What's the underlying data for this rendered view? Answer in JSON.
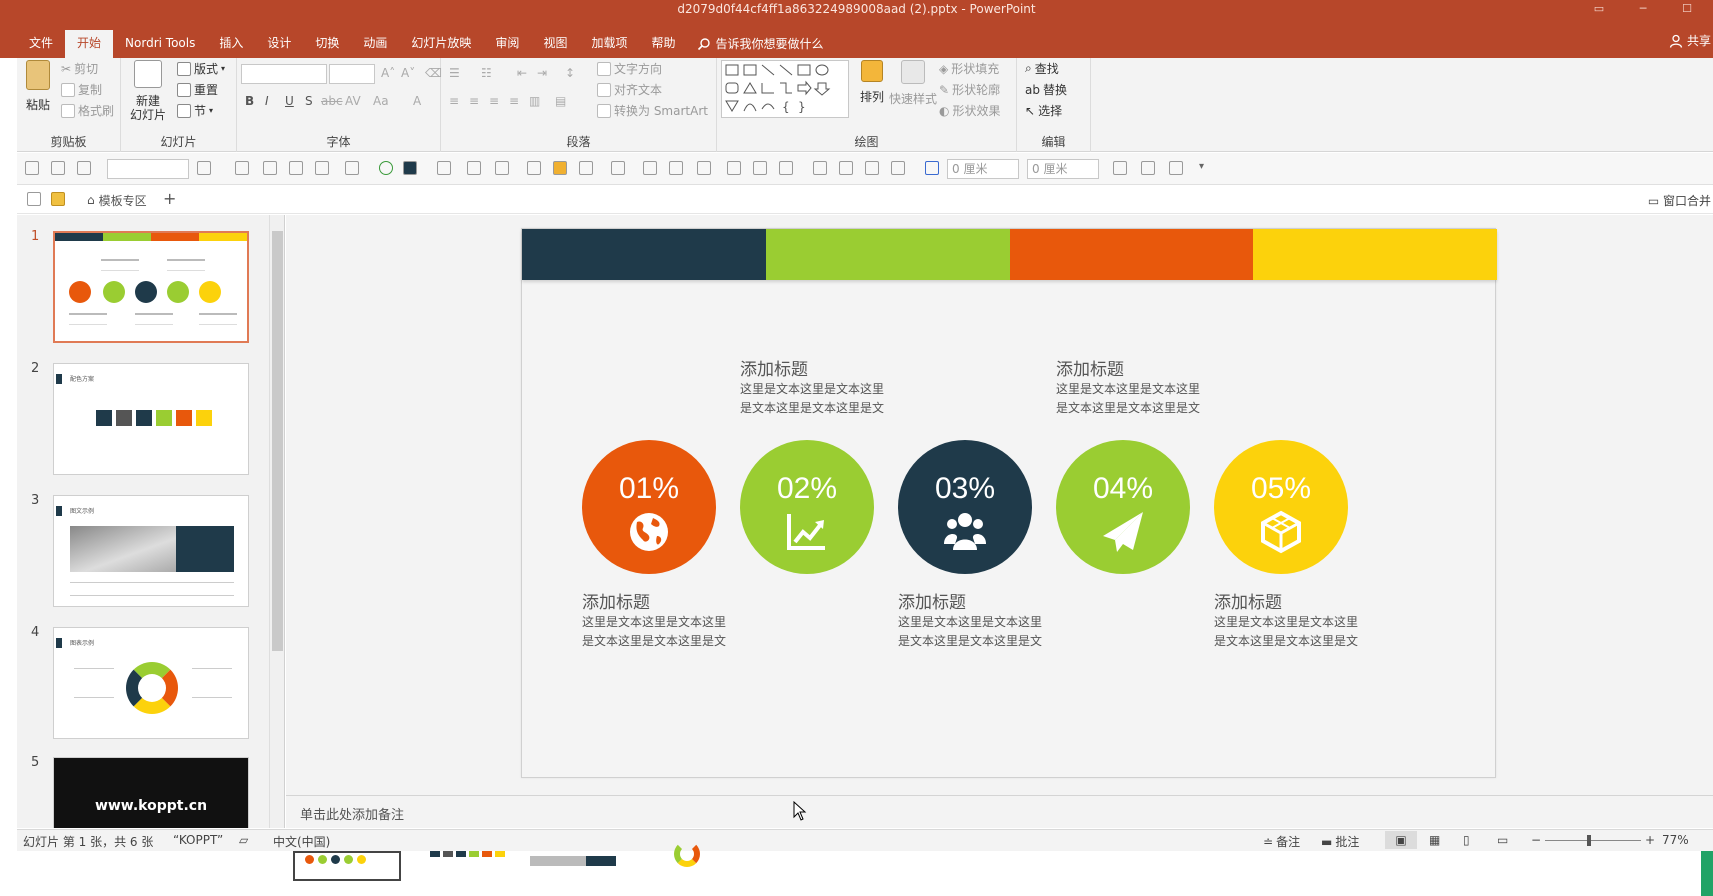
{
  "window": {
    "title": "d2079d0f44cf4ff1a863224989008aad (2).pptx  -  PowerPoint"
  },
  "tabs": [
    "文件",
    "开始",
    "Nordri Tools",
    "插入",
    "设计",
    "切换",
    "动画",
    "幻灯片放映",
    "审阅",
    "视图",
    "加载项",
    "帮助"
  ],
  "active_tab": "开始",
  "tell_me": "告诉我你想要做什么",
  "share": "共享",
  "ribbon": {
    "clipboard": {
      "label": "剪贴板",
      "paste": "粘贴",
      "cut": "剪切",
      "copy": "复制",
      "format_painter": "格式刷"
    },
    "slides": {
      "label": "幻灯片",
      "new_slide": "新建\n幻灯片",
      "layout": "版式",
      "reset": "重置",
      "section": "节"
    },
    "font": {
      "label": "字体"
    },
    "paragraph": {
      "label": "段落",
      "text_direction": "文字方向",
      "align_text": "对齐文本",
      "smartart": "转换为 SmartArt"
    },
    "drawing": {
      "label": "绘图",
      "arrange": "排列",
      "quick_styles": "快速样式",
      "shape_fill": "形状填充",
      "shape_outline": "形状轮廓",
      "shape_effects": "形状效果"
    },
    "editing": {
      "label": "编辑",
      "find": "查找",
      "replace": "替换",
      "select": "选择"
    }
  },
  "toolbar2": {
    "width_field": "0 厘米",
    "height_field": "0 厘米"
  },
  "toolbar3": {
    "template_zone": "模板专区",
    "window_merge": "窗口合并"
  },
  "thumbnails": [
    {
      "num": "1",
      "selected": true
    },
    {
      "num": "2",
      "caption": "配色方案"
    },
    {
      "num": "3",
      "caption": "图文示例"
    },
    {
      "num": "4",
      "caption": "图表示例"
    },
    {
      "num": "5",
      "site": "www.koppt.cn"
    }
  ],
  "slide": {
    "colors": [
      "#1f3a4a",
      "#9acd32",
      "#e8580c",
      "#fcd20c"
    ],
    "items": [
      {
        "percent": "01%",
        "color": "#e8580c",
        "icon": "globe-icon",
        "title": "添加标题",
        "text": "这里是文本这里是文本这里是文本这里是文本这里是文",
        "position": "below"
      },
      {
        "percent": "02%",
        "color": "#9acd32",
        "icon": "chart-line-icon",
        "title": "添加标题",
        "text": "这里是文本这里是文本这里是文本这里是文本这里是文",
        "position": "above"
      },
      {
        "percent": "03%",
        "color": "#1f3a4a",
        "icon": "users-icon",
        "title": "添加标题",
        "text": "这里是文本这里是文本这里是文本这里是文本这里是文",
        "position": "below"
      },
      {
        "percent": "04%",
        "color": "#9acd32",
        "icon": "paper-plane-icon",
        "title": "添加标题",
        "text": "这里是文本这里是文本这里是文本这里是文本这里是文",
        "position": "above"
      },
      {
        "percent": "05%",
        "color": "#fcd20c",
        "icon": "cube-icon",
        "title": "添加标题",
        "text": "这里是文本这里是文本这里是文本这里是文本这里是文",
        "position": "below"
      }
    ]
  },
  "notes_placeholder": "单击此处添加备注",
  "status": {
    "slide_info": "幻灯片 第 1 张，共 6 张",
    "theme": "“KOPPT”",
    "language": "中文(中国)",
    "notes": "备注",
    "comments": "批注",
    "zoom": "77%"
  }
}
